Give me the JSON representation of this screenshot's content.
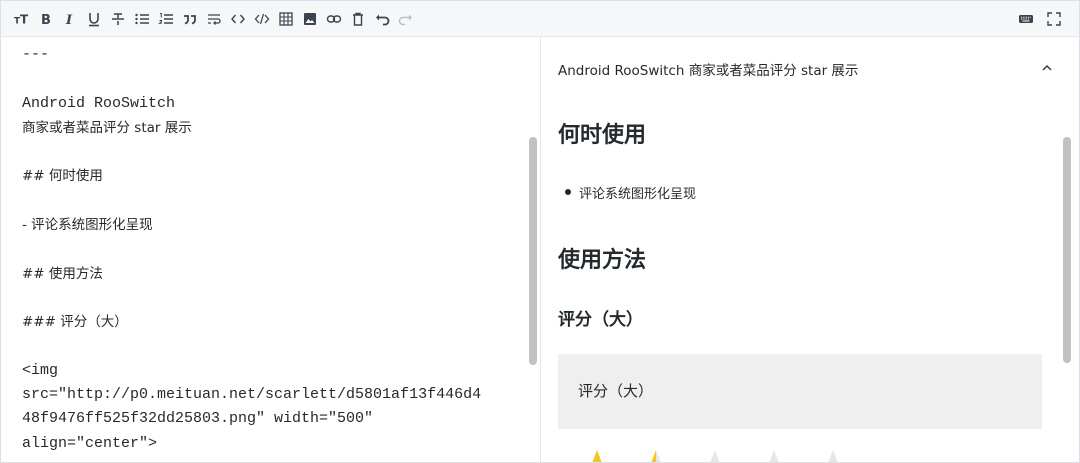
{
  "toolbar": {
    "left_icons": [
      "text-size-icon",
      "bold-icon",
      "italic-icon",
      "underline-icon",
      "strikethrough-icon",
      "unordered-list-icon",
      "ordered-list-icon",
      "quote-icon",
      "wrap-icon",
      "inline-code-icon",
      "code-block-icon",
      "table-icon",
      "image-icon",
      "link-icon",
      "delete-icon",
      "undo-icon",
      "redo-icon"
    ],
    "right_icons": [
      "keyboard-icon",
      "fullscreen-icon"
    ],
    "labels": {
      "heading": "TT",
      "bold": "B",
      "italic": "I",
      "underline": "U",
      "strike": "S"
    }
  },
  "source": {
    "lines": [
      "---",
      "",
      "Android RooSwitch",
      "商家或者菜品评分 star 展示",
      "",
      "## 何时使用",
      "",
      "- 评论系统图形化呈现",
      "",
      "## 使用方法",
      "",
      "### 评分（大）",
      "",
      "<img",
      "src=\"http://p0.meituan.net/scarlett/d5801af13f446d4",
      "48f9476ff525f32dd25803.png\" width=\"500\"",
      "align=\"center\">"
    ]
  },
  "preview": {
    "intro": "Android RooSwitch 商家或者菜品评分 star 展示",
    "h2_when": "何时使用",
    "bullet": "评论系统图形化呈现",
    "h2_usage": "使用方法",
    "h3_rating": "评分（大）",
    "quote_rating": "评分（大）",
    "star_rating": 1.5,
    "star_max": 5
  },
  "colors": {
    "star_filled": "#f7c325",
    "star_empty": "#e6e6e6"
  }
}
